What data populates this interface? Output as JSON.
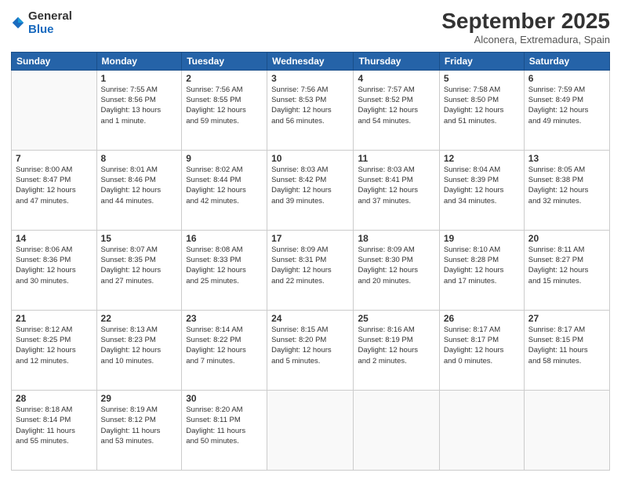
{
  "logo": {
    "general": "General",
    "blue": "Blue"
  },
  "header": {
    "month": "September 2025",
    "location": "Alconera, Extremadura, Spain"
  },
  "days_of_week": [
    "Sunday",
    "Monday",
    "Tuesday",
    "Wednesday",
    "Thursday",
    "Friday",
    "Saturday"
  ],
  "weeks": [
    [
      {
        "day": "",
        "info": ""
      },
      {
        "day": "1",
        "info": "Sunrise: 7:55 AM\nSunset: 8:56 PM\nDaylight: 13 hours\nand 1 minute."
      },
      {
        "day": "2",
        "info": "Sunrise: 7:56 AM\nSunset: 8:55 PM\nDaylight: 12 hours\nand 59 minutes."
      },
      {
        "day": "3",
        "info": "Sunrise: 7:56 AM\nSunset: 8:53 PM\nDaylight: 12 hours\nand 56 minutes."
      },
      {
        "day": "4",
        "info": "Sunrise: 7:57 AM\nSunset: 8:52 PM\nDaylight: 12 hours\nand 54 minutes."
      },
      {
        "day": "5",
        "info": "Sunrise: 7:58 AM\nSunset: 8:50 PM\nDaylight: 12 hours\nand 51 minutes."
      },
      {
        "day": "6",
        "info": "Sunrise: 7:59 AM\nSunset: 8:49 PM\nDaylight: 12 hours\nand 49 minutes."
      }
    ],
    [
      {
        "day": "7",
        "info": "Sunrise: 8:00 AM\nSunset: 8:47 PM\nDaylight: 12 hours\nand 47 minutes."
      },
      {
        "day": "8",
        "info": "Sunrise: 8:01 AM\nSunset: 8:46 PM\nDaylight: 12 hours\nand 44 minutes."
      },
      {
        "day": "9",
        "info": "Sunrise: 8:02 AM\nSunset: 8:44 PM\nDaylight: 12 hours\nand 42 minutes."
      },
      {
        "day": "10",
        "info": "Sunrise: 8:03 AM\nSunset: 8:42 PM\nDaylight: 12 hours\nand 39 minutes."
      },
      {
        "day": "11",
        "info": "Sunrise: 8:03 AM\nSunset: 8:41 PM\nDaylight: 12 hours\nand 37 minutes."
      },
      {
        "day": "12",
        "info": "Sunrise: 8:04 AM\nSunset: 8:39 PM\nDaylight: 12 hours\nand 34 minutes."
      },
      {
        "day": "13",
        "info": "Sunrise: 8:05 AM\nSunset: 8:38 PM\nDaylight: 12 hours\nand 32 minutes."
      }
    ],
    [
      {
        "day": "14",
        "info": "Sunrise: 8:06 AM\nSunset: 8:36 PM\nDaylight: 12 hours\nand 30 minutes."
      },
      {
        "day": "15",
        "info": "Sunrise: 8:07 AM\nSunset: 8:35 PM\nDaylight: 12 hours\nand 27 minutes."
      },
      {
        "day": "16",
        "info": "Sunrise: 8:08 AM\nSunset: 8:33 PM\nDaylight: 12 hours\nand 25 minutes."
      },
      {
        "day": "17",
        "info": "Sunrise: 8:09 AM\nSunset: 8:31 PM\nDaylight: 12 hours\nand 22 minutes."
      },
      {
        "day": "18",
        "info": "Sunrise: 8:09 AM\nSunset: 8:30 PM\nDaylight: 12 hours\nand 20 minutes."
      },
      {
        "day": "19",
        "info": "Sunrise: 8:10 AM\nSunset: 8:28 PM\nDaylight: 12 hours\nand 17 minutes."
      },
      {
        "day": "20",
        "info": "Sunrise: 8:11 AM\nSunset: 8:27 PM\nDaylight: 12 hours\nand 15 minutes."
      }
    ],
    [
      {
        "day": "21",
        "info": "Sunrise: 8:12 AM\nSunset: 8:25 PM\nDaylight: 12 hours\nand 12 minutes."
      },
      {
        "day": "22",
        "info": "Sunrise: 8:13 AM\nSunset: 8:23 PM\nDaylight: 12 hours\nand 10 minutes."
      },
      {
        "day": "23",
        "info": "Sunrise: 8:14 AM\nSunset: 8:22 PM\nDaylight: 12 hours\nand 7 minutes."
      },
      {
        "day": "24",
        "info": "Sunrise: 8:15 AM\nSunset: 8:20 PM\nDaylight: 12 hours\nand 5 minutes."
      },
      {
        "day": "25",
        "info": "Sunrise: 8:16 AM\nSunset: 8:19 PM\nDaylight: 12 hours\nand 2 minutes."
      },
      {
        "day": "26",
        "info": "Sunrise: 8:17 AM\nSunset: 8:17 PM\nDaylight: 12 hours\nand 0 minutes."
      },
      {
        "day": "27",
        "info": "Sunrise: 8:17 AM\nSunset: 8:15 PM\nDaylight: 11 hours\nand 58 minutes."
      }
    ],
    [
      {
        "day": "28",
        "info": "Sunrise: 8:18 AM\nSunset: 8:14 PM\nDaylight: 11 hours\nand 55 minutes."
      },
      {
        "day": "29",
        "info": "Sunrise: 8:19 AM\nSunset: 8:12 PM\nDaylight: 11 hours\nand 53 minutes."
      },
      {
        "day": "30",
        "info": "Sunrise: 8:20 AM\nSunset: 8:11 PM\nDaylight: 11 hours\nand 50 minutes."
      },
      {
        "day": "",
        "info": ""
      },
      {
        "day": "",
        "info": ""
      },
      {
        "day": "",
        "info": ""
      },
      {
        "day": "",
        "info": ""
      }
    ]
  ]
}
